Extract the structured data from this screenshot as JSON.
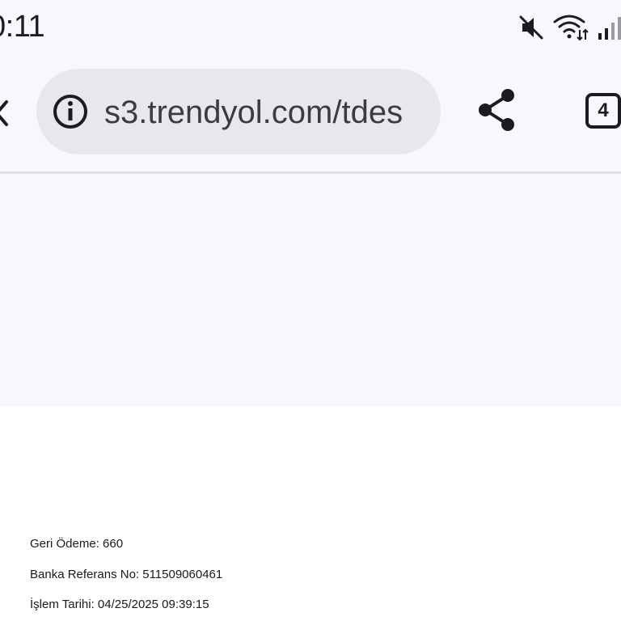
{
  "status_bar": {
    "time": "0:11",
    "icons": [
      "mute-icon",
      "wifi-icon",
      "signal-icon"
    ]
  },
  "browser": {
    "url": "s3.trendyol.com/tdes",
    "tab_count": "4",
    "icons": [
      "back-arrow-icon",
      "info-icon",
      "share-icon"
    ]
  },
  "document": {
    "lines": [
      "Geri Ödeme: 660",
      "Banka Referans No: 511509060461",
      "İşlem Tarihi: 04/25/2025 09:39:15"
    ]
  },
  "colors": {
    "chrome_background": "#f8f7fb",
    "url_bar_background": "#e9e7ee",
    "icon_color": "#1c1b1f"
  }
}
